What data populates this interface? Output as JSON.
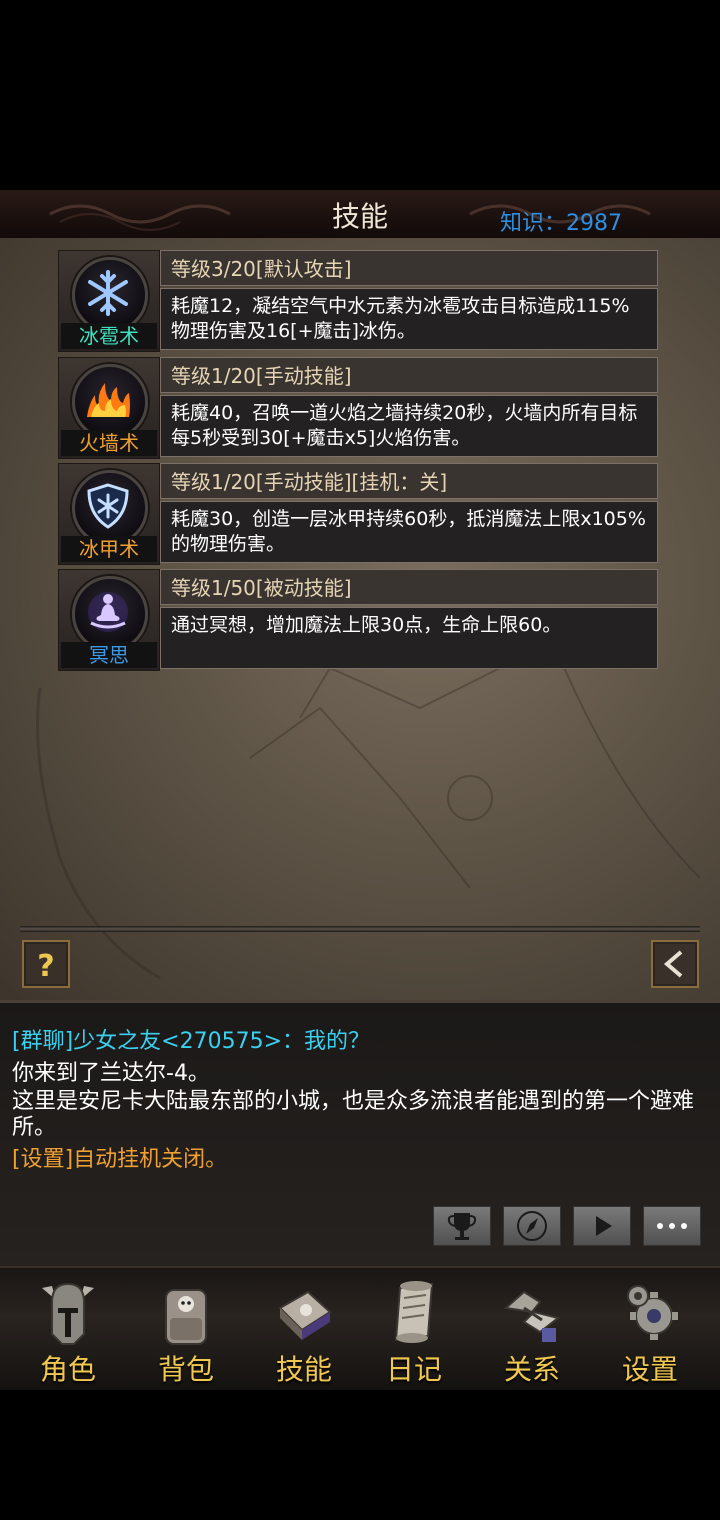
{
  "header": {
    "title": "技能",
    "knowledge": "知识：2987"
  },
  "skills": [
    {
      "name": "冰雹术",
      "name_color": "#3fe0c0",
      "level": "等级3/20[默认攻击]",
      "desc": "耗魔12，凝结空气中水元素为冰雹攻击目标造成115%物理伤害及16[+魔击]冰伤。",
      "icon": "snowflake-icon"
    },
    {
      "name": "火墙术",
      "name_color": "#f0a030",
      "level": "等级1/20[手动技能]",
      "desc": "耗魔40，召唤一道火焰之墙持续20秒，火墙内所有目标每5秒受到30[+魔击x5]火焰伤害。",
      "icon": "fire-wall-icon"
    },
    {
      "name": "冰甲术",
      "name_color": "#f0a030",
      "level": "等级1/20[手动技能][挂机：关]",
      "desc": "耗魔30，创造一层冰甲持续60秒，抵消魔法上限x105%的物理伤害。",
      "icon": "ice-shield-icon"
    },
    {
      "name": "冥思",
      "name_color": "#3a9ae8",
      "level": "等级1/50[被动技能]",
      "desc": "通过冥想，增加魔法上限30点，生命上限60。",
      "icon": "meditation-icon"
    }
  ],
  "chat": {
    "lines": [
      {
        "text": "[群聊]少女之友<270575>：我的？",
        "color": "#3ad0f0"
      },
      {
        "text": "你来到了兰达尔-4。",
        "color": "#ffffff"
      },
      {
        "text": "这里是安尼卡大陆最东部的小城，也是众多流浪者能遇到的第一个避难所。",
        "color": "#ffffff"
      },
      {
        "text": "[设置]自动挂机关闭。",
        "color": "#f0a030"
      }
    ],
    "buttons": [
      "trophy-icon",
      "compass-icon",
      "play-icon",
      "more-icon"
    ]
  },
  "nav": [
    {
      "label": "角色",
      "icon": "helmet-icon"
    },
    {
      "label": "背包",
      "icon": "backpack-icon"
    },
    {
      "label": "技能",
      "icon": "spellbook-icon"
    },
    {
      "label": "日记",
      "icon": "scroll-icon"
    },
    {
      "label": "关系",
      "icon": "handshake-icon"
    },
    {
      "label": "设置",
      "icon": "gear-icon"
    }
  ],
  "colors": {
    "accent": "#f0c850",
    "knowledge": "#2f8fe0"
  }
}
